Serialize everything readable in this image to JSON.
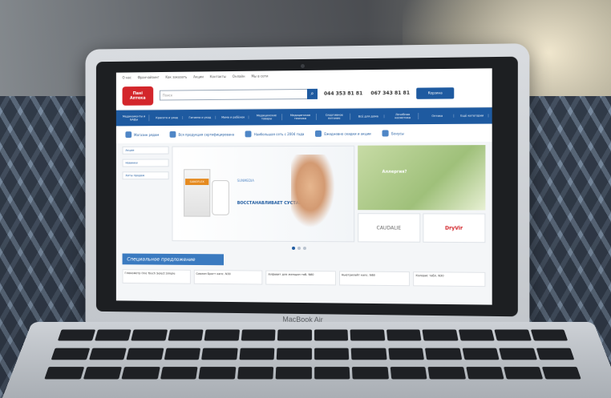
{
  "site": {
    "topbar_links": [
      "О нас",
      "Франчайзинг",
      "Как заказать",
      "Акции",
      "Контакты",
      "Онлайн",
      "Мы в сети"
    ],
    "logo_line1": "Пані",
    "logo_line2": "Аптека",
    "search_placeholder": "Поиск",
    "phone1": "044 353 81 81",
    "phone2": "067 343 81 81",
    "cart_label": "Корзина",
    "nav_items": [
      "Медикаменты и БАДы",
      "Красота и уход",
      "Гигиена и уход",
      "Мама и ребёнок",
      "Медицинские товары",
      "Медицинская техника",
      "Спортивное питание",
      "Всё для дома",
      "Лечебная косметика",
      "Оптика",
      "Ещё категории"
    ],
    "benefits": [
      "Магазин рядом",
      "Вся продукция сертифицирована",
      "Наибольшая сеть с 2004 года",
      "Ежедневно скидки и акции",
      "Бонусы"
    ],
    "sidebar_items": [
      "Акции",
      "Новинки",
      "Хиты продаж"
    ],
    "banner_brand": "SANOFLEX",
    "banner_logo": "SUNMEDIA",
    "banner_text": "ВОССТАНАВЛИВАЕТ СУСТАВЫ",
    "promo_green_text": "Аллергия?",
    "promo_left": "CAUDALIE",
    "promo_right": "DryVir",
    "special_title": "Специальное предложение",
    "products": [
      "Глюкометр One Touch Select Simple",
      "Сиалин Брогт капс. N30",
      "Алфавит для женщин таб. N60",
      "Ньютрилайт капс. N60",
      "Кэлорис табл. N30"
    ]
  },
  "device_label": "MacBook Air"
}
